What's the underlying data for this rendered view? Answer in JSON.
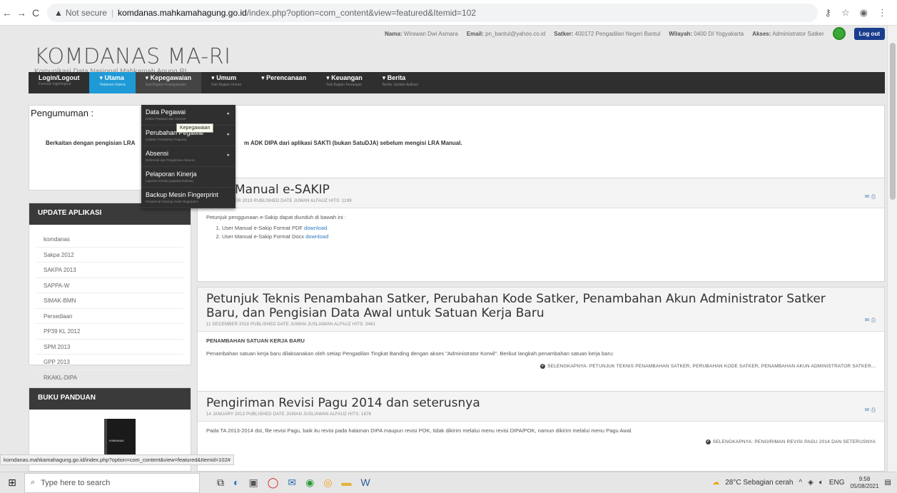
{
  "browser": {
    "warning": "▲",
    "not_secure": "Not secure",
    "domain": "komdanas.mahkamahagung.go.id",
    "path": "/index.php?option=com_content&view=featured&Itemid=102"
  },
  "userbar": {
    "nama_label": "Nama:",
    "nama": "Wirawan Dwi Asmara",
    "email_label": "Email:",
    "email": "pn_bantul@yahoo.co.id",
    "satker_label": "Satker:",
    "satker": "400172 Pengadilan Negeri Bantul",
    "wilayah_label": "Wilayah:",
    "wilayah": "0400 DI Yogyakarta",
    "akses_label": "Akses:",
    "akses": "Administrator Satker",
    "logout": "Log out"
  },
  "logo": {
    "title": "KOMDANAS MA-RI",
    "subtitle": "Komunikasi Data Nasional Mahkamah Agung RI"
  },
  "nav": {
    "items": [
      {
        "title": "Login/Logout",
        "sub": "Formulir login/logout"
      },
      {
        "title": "▾ Utama",
        "sub": "Halaman Utama"
      },
      {
        "title": "▾ Kepegawaian",
        "sub": "Sub Bagian Kepegawaian"
      },
      {
        "title": "▾ Umum",
        "sub": "Sub Bagian Umum"
      },
      {
        "title": "▾ Perencanaan",
        "sub": ""
      },
      {
        "title": "▾ Keuangan",
        "sub": "Sub Bagian Keuangan"
      },
      {
        "title": "▾ Berita",
        "sub": "Berita, Update Aplikasi"
      }
    ]
  },
  "dropdown": {
    "items": [
      {
        "title": "Data Pegawai",
        "sub": "Daftar Pegawai dan Honorer"
      },
      {
        "title": "Perubahan Pegawai",
        "sub": "Catatan Perubahan Pegawai"
      },
      {
        "title": "Absensi",
        "sub": "Referensi dan Pengiriman Absensi"
      },
      {
        "title": "Pelaporan Kinerja",
        "sub": "Laporan Kinerja pegawai bulanan"
      },
      {
        "title": "Backup Mesin Fingerprint",
        "sub": "Pengiriman backup mesin fingerprint"
      }
    ],
    "tooltip": "Kepegawaian"
  },
  "announcement": {
    "title": "Pengumuman :",
    "msg_left": "Berkaitan dengan pengisian LRA",
    "msg_right": "m ADK DIPA dari aplikasi SAKTI (bukan SatuDJA) sebelum mengisi LRA Manual."
  },
  "update_panel": {
    "title": "UPDATE APLIKASI",
    "items": [
      "komdanas",
      "Sakpa 2012",
      "SAKPA 2013",
      "SAPPA-W",
      "SIMAK-BMN",
      "Persediaan",
      "PP39 KL 2012",
      "SPM 2013",
      "GPP 2013",
      "RKAKL-DIPA"
    ]
  },
  "buku_panel": {
    "title": "BUKU PANDUAN",
    "book_label": "KOMDANAS"
  },
  "articles": [
    {
      "title": "Manual e-SAKIP",
      "meta": "ER 2019  PUBLISHED DATE  JUWAN ALFAUZ  HITS: 1199",
      "intro": "Petunjuk penggunaan e-Sakip dapat diunduh di bawah ini :",
      "list": [
        {
          "text": "User Manual e-Sakip Format PDF ",
          "link": "download"
        },
        {
          "text": "User Manual e-Sakip Format Docx ",
          "link": "download"
        }
      ]
    },
    {
      "title": "Petunjuk Teknis Penambahan Satker, Perubahan Kode Satker, Penambahan Akun Administrator Satker Baru, dan Pengisian Data Awal untuk Satuan Kerja Baru",
      "meta": "11 DECEMBER 2018  PUBLISHED DATE  JUWAN JUSLIAWAN ALFAUZ  HITS: 3461",
      "heading": "PENAMBAHAN SATUAN KERJA BARU",
      "body": "Penambahan satuan kerja baru dilaksanakan oleh setiap Pengadilan Tingkat Banding dengan akses \"Administrator Korwil\". Berikut langkah penambahan satuan kerja baru:",
      "more": "SELENGKAPNYA: PETUNJUK TEKNIS PENAMBAHAN SATKER, PERUBAHAN KODE SATKER, PENAMBAHAN AKUN ADMINISTRATOR SATKER..."
    },
    {
      "title": "Pengiriman Revisi Pagu 2014 dan seterusnya",
      "meta": "14 JANUARY 2013  PUBLISHED DATE  JUWAN JUSLIAWAN ALFAUZ  HITS: 1676",
      "body": "Pada TA 2013-2014 dst, file revisi Pagu, baik itu revisi pada halaman DIPA maupun revisi POK, tidak dikirim melalui menu revisi DIPA/POK, namun dikirim melalui menu Pagu Awal.",
      "more": "SELENGKAPNYA: PENGIRIMAN REVISI PAGU 2014 DAN SETERUSNYA"
    }
  ],
  "status_url": "komdanas.mahkamahagung.go.id/index.php?option=com_content&view=featured&Itemid=102#",
  "taskbar": {
    "search_placeholder": "Type here to search",
    "weather": "28°C  Sebagian cerah",
    "lang": "ENG",
    "time": "9:58",
    "date": "05/08/2021"
  }
}
